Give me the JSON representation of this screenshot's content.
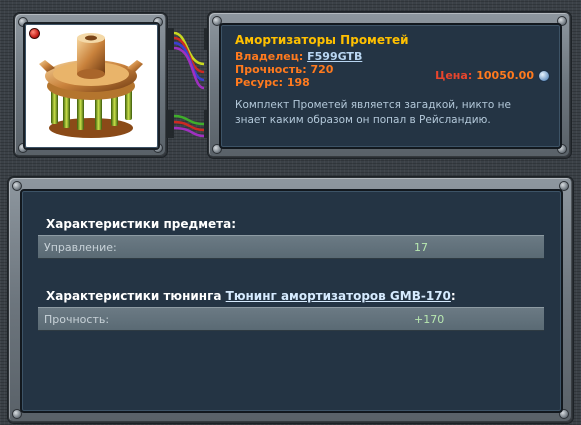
{
  "item": {
    "title": "Амортизаторы Прометей",
    "owner_label": "Владелец:",
    "owner": "F599GTB",
    "durability_label": "Прочность:",
    "durability": "720",
    "resource_label": "Ресурс:",
    "resource": "198",
    "price_label": "Цена:",
    "price": "10050.00",
    "description": "Комплект Прометей является загадкой, никто не знает каким образом он попал в Рейсландию."
  },
  "characteristics": {
    "title": "Характеристики предмета:",
    "rows": [
      {
        "label": "Управление:",
        "value": "17"
      }
    ]
  },
  "tuning": {
    "title_prefix": "Характеристики тюнинга",
    "link": "Тюнинг амортизаторов GMB-170",
    "title_suffix": ":",
    "rows": [
      {
        "label": "Прочность:",
        "value": "+170"
      }
    ]
  },
  "icons": {
    "status_led": "red-led-icon",
    "currency": "coin-icon",
    "item_image": "shock-absorber-image"
  },
  "colors": {
    "title": "#ffc000",
    "label_orange": "#ff7a1e",
    "price": "#e8452d",
    "stat_value": "#b8e8b0"
  }
}
